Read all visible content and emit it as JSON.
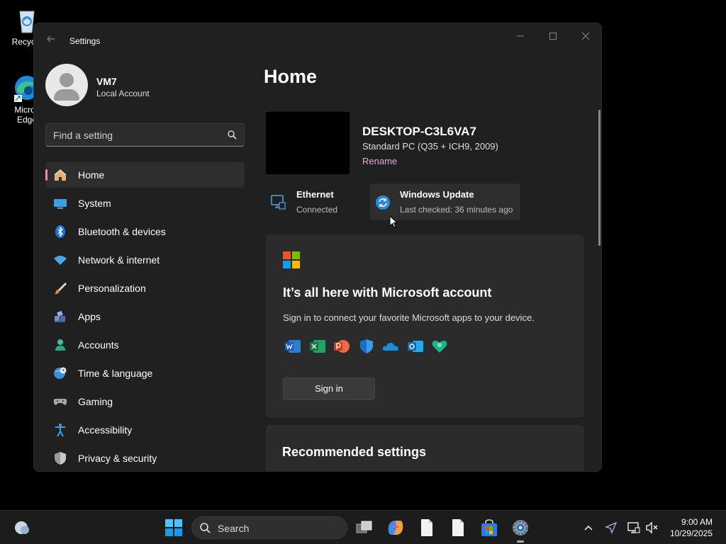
{
  "desktop": {
    "icons": [
      {
        "label": "Recycle Bin",
        "visible_label": "Recycle",
        "icon": "recycle-bin-icon"
      },
      {
        "label": "Microsoft Edge",
        "visible_label": "Micros Edge",
        "icon": "edge-icon"
      }
    ]
  },
  "window": {
    "title": "Settings",
    "back_icon": "back-arrow-icon",
    "controls": {
      "minimize": "—",
      "maximize": "☐",
      "close": "✕"
    }
  },
  "user": {
    "name": "VM7",
    "account_type": "Local Account"
  },
  "search": {
    "placeholder": "Find a setting"
  },
  "nav": {
    "items": [
      {
        "label": "Home",
        "icon": "home-icon",
        "active": true
      },
      {
        "label": "System",
        "icon": "system-icon"
      },
      {
        "label": "Bluetooth & devices",
        "icon": "bluetooth-icon"
      },
      {
        "label": "Network & internet",
        "icon": "wifi-icon"
      },
      {
        "label": "Personalization",
        "icon": "brush-icon"
      },
      {
        "label": "Apps",
        "icon": "apps-icon"
      },
      {
        "label": "Accounts",
        "icon": "accounts-icon"
      },
      {
        "label": "Time & language",
        "icon": "globe-clock-icon"
      },
      {
        "label": "Gaming",
        "icon": "gamepad-icon"
      },
      {
        "label": "Accessibility",
        "icon": "accessibility-icon"
      },
      {
        "label": "Privacy & security",
        "icon": "shield-icon"
      }
    ]
  },
  "home": {
    "title": "Home",
    "device": {
      "name": "DESKTOP-C3L6VA7",
      "model": "Standard PC (Q35 + ICH9, 2009)",
      "rename": "Rename"
    },
    "status": {
      "ethernet": {
        "title": "Ethernet",
        "sub": "Connected"
      },
      "update": {
        "title": "Windows Update",
        "sub": "Last checked: 36 minutes ago"
      }
    },
    "ms_card": {
      "title": "It’s all here with Microsoft account",
      "desc": "Sign in to connect your favorite Microsoft apps to your device.",
      "apps": [
        "word-icon",
        "excel-icon",
        "powerpoint-icon",
        "defender-icon",
        "onedrive-icon",
        "outlook-icon",
        "family-icon"
      ],
      "button": "Sign in"
    },
    "recommended": {
      "title": "Recommended settings"
    }
  },
  "taskbar": {
    "search_label": "Search",
    "time": "9:00 AM",
    "date": "10/29/2025"
  },
  "colors": {
    "accent": "#e88cc8",
    "window_bg": "#202020",
    "card_bg": "#2b2b2b"
  }
}
